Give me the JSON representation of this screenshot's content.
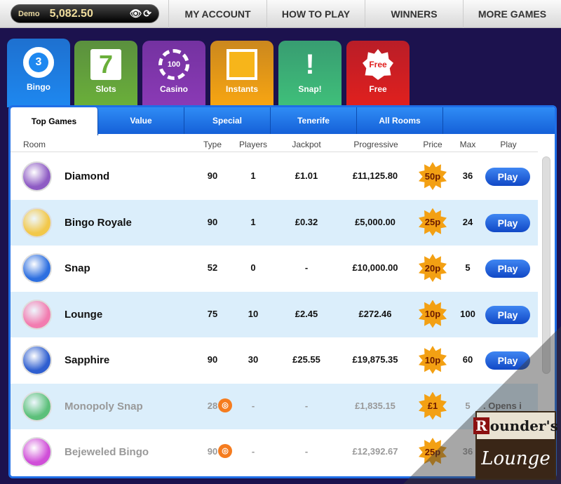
{
  "balance": {
    "label": "Demo",
    "amount": "5,082.50",
    "icons": [
      "eye-icon",
      "refresh-icon"
    ]
  },
  "nav": [
    "MY ACCOUNT",
    "HOW TO PLAY",
    "WINNERS",
    "MORE GAMES"
  ],
  "categories": [
    {
      "label": "Bingo",
      "icon": "3",
      "color": "#1e88f0"
    },
    {
      "label": "Slots",
      "icon": "7",
      "color": "#6aaf3a"
    },
    {
      "label": "Casino",
      "icon": "100",
      "color": "#8a3ab5"
    },
    {
      "label": "Instants",
      "icon": "",
      "color": "#f7a512"
    },
    {
      "label": "Snap!",
      "icon": "!",
      "color": "#3fbf7a"
    },
    {
      "label": "Free",
      "icon": "Free",
      "color": "#e0201e"
    }
  ],
  "subtabs": [
    "Top Games",
    "Value",
    "Special",
    "Tenerife",
    "All Rooms"
  ],
  "columns": [
    "Room",
    "Type",
    "Players",
    "Jackpot",
    "Progressive",
    "Price",
    "Max",
    "Play"
  ],
  "rows": [
    {
      "name": "Diamond",
      "type": "90",
      "players": "1",
      "jackpot": "£1.01",
      "progressive": "£11,125.80",
      "price": "50p",
      "max": "36",
      "play": "Play",
      "color": "#8e5bc4"
    },
    {
      "name": "Bingo Royale",
      "type": "90",
      "players": "1",
      "jackpot": "£0.32",
      "progressive": "£5,000.00",
      "price": "25p",
      "max": "24",
      "play": "Play",
      "color": "#f2c84a"
    },
    {
      "name": "Snap",
      "type": "52",
      "players": "0",
      "jackpot": "-",
      "progressive": "£10,000.00",
      "price": "20p",
      "max": "5",
      "play": "Play",
      "color": "#2d6fe0"
    },
    {
      "name": "Lounge",
      "type": "75",
      "players": "10",
      "jackpot": "£2.45",
      "progressive": "£272.46",
      "price": "10p",
      "max": "100",
      "play": "Play",
      "color": "#f27cb0"
    },
    {
      "name": "Sapphire",
      "type": "90",
      "players": "30",
      "jackpot": "£25.55",
      "progressive": "£19,875.35",
      "price": "10p",
      "max": "60",
      "play": "Play",
      "color": "#2f5fd0"
    },
    {
      "name": "Monopoly Snap",
      "type": "28",
      "players": "-",
      "jackpot": "-",
      "progressive": "£1,835.15",
      "price": "£1",
      "max": "5",
      "play": ". Opens i",
      "color": "#5cc07a"
    },
    {
      "name": "Bejeweled Bingo",
      "type": "90",
      "players": "-",
      "jackpot": "-",
      "progressive": "£12,392.67",
      "price": "25p",
      "max": "36",
      "play": "",
      "color": "#d04fd8"
    }
  ],
  "logo": {
    "line1": "Rounder's",
    "line2": "Lounge"
  }
}
